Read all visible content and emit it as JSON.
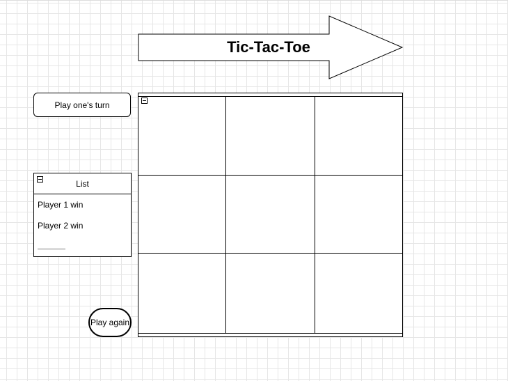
{
  "title": "Tic-Tac-Toe",
  "controls": {
    "turn_button_label": "Play one's turn",
    "play_again_label": "Play again"
  },
  "list": {
    "header": "List",
    "items": [
      "Player 1 win",
      "Player 2 win"
    ]
  },
  "board": {
    "rows": 3,
    "cols": 3,
    "cells": [
      [
        "",
        "",
        ""
      ],
      [
        "",
        "",
        ""
      ],
      [
        "",
        "",
        ""
      ]
    ]
  },
  "colors": {
    "stroke": "#000000",
    "grid": "#e6e6e6",
    "fill": "#ffffff"
  }
}
